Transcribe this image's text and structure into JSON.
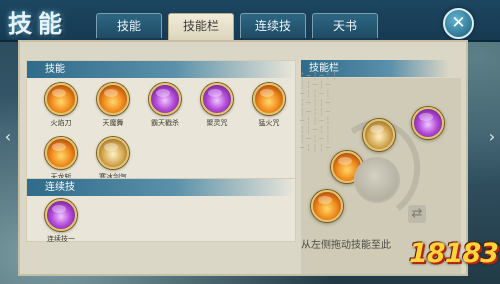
{
  "header": {
    "title": "技能",
    "tabs": [
      {
        "label": "技能",
        "active": false
      },
      {
        "label": "技能栏",
        "active": true
      },
      {
        "label": "连续技",
        "active": false
      },
      {
        "label": "天书",
        "active": false
      }
    ],
    "close_icon": "✕"
  },
  "skills_section": {
    "title": "技能",
    "items": [
      {
        "label": "火焰刀",
        "icon": "fire-slash-icon"
      },
      {
        "label": "天魔舞",
        "icon": "demon-dance-icon"
      },
      {
        "label": "霸天戳杀",
        "icon": "purple-thrust-icon"
      },
      {
        "label": "聚灵咒",
        "icon": "spirit-gather-icon"
      },
      {
        "label": "猛火咒",
        "icon": "fierce-fire-icon"
      },
      {
        "label": "天龙斩",
        "icon": "dragon-slash-icon"
      },
      {
        "label": "寒冰剑气",
        "icon": "ice-sword-icon"
      }
    ]
  },
  "combo_section": {
    "title": "连续技",
    "items": [
      {
        "label": "连续技一",
        "icon": "combo-purple-icon"
      }
    ]
  },
  "skillbar_section": {
    "title": "技能栏",
    "hint": "从左侧拖动技能至此"
  },
  "nav": {
    "left_arrow": "‹",
    "right_arrow": "›"
  },
  "watermark": {
    "text": "18183"
  },
  "colors": {
    "fire": "#f08a1c",
    "purple": "#b34bd8",
    "gold": "#d5a752",
    "header_blue": "#2f6b8a"
  }
}
